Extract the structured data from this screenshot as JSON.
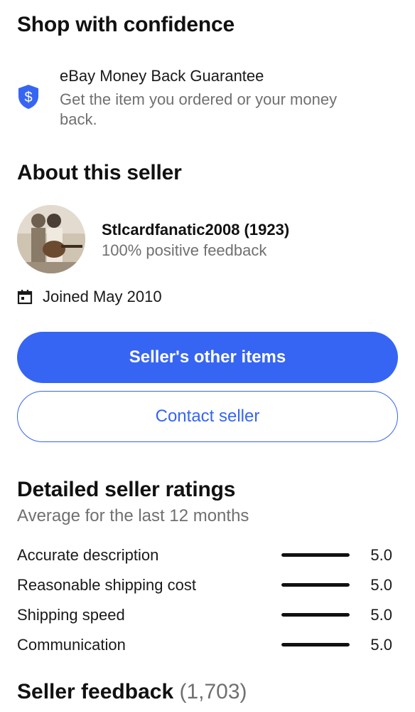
{
  "confidence": {
    "title": "Shop with confidence",
    "guarantee_title": "eBay Money Back Guarantee",
    "guarantee_desc": "Get the item you ordered or your money back.",
    "icon": "shield-dollar-icon"
  },
  "seller": {
    "section_title": "About this seller",
    "name": "Stlcardfanatic2008 (1923)",
    "feedback": "100% positive feedback",
    "joined": "Joined May 2010",
    "joined_icon": "calendar-icon"
  },
  "buttons": {
    "other_items": "Seller's other items",
    "contact": "Contact seller"
  },
  "ratings": {
    "title": "Detailed seller ratings",
    "subtitle": "Average for the last 12 months",
    "max": 5.0,
    "items": [
      {
        "label": "Accurate description",
        "value": "5.0",
        "score": 5.0
      },
      {
        "label": "Reasonable shipping cost",
        "value": "5.0",
        "score": 5.0
      },
      {
        "label": "Shipping speed",
        "value": "5.0",
        "score": 5.0
      },
      {
        "label": "Communication",
        "value": "5.0",
        "score": 5.0
      }
    ]
  },
  "feedback": {
    "title": "Seller feedback",
    "count": "(1,703)"
  },
  "colors": {
    "accent": "#3665f3",
    "text": "#191919",
    "muted": "#707070"
  }
}
